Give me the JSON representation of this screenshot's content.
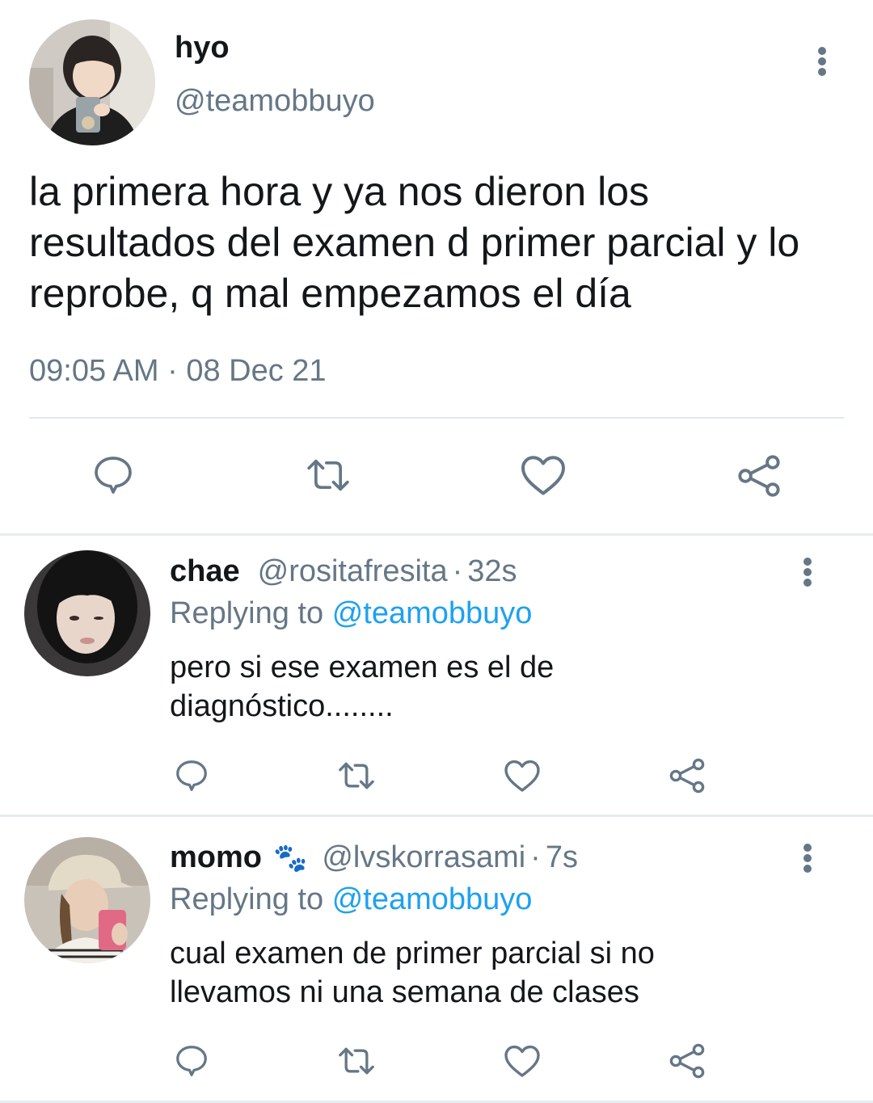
{
  "main_tweet": {
    "display_name": "hyo",
    "handle": "@teamobbuyo",
    "text": "la primera hora y ya nos dieron los resultados del examen d primer parcial y lo reprobe, q mal empezamos el día",
    "timestamp": "09:05 AM · 08 Dec 21",
    "actions": [
      "reply-icon",
      "retweet-icon",
      "like-icon",
      "share-icon"
    ]
  },
  "replies": [
    {
      "display_name": "chae",
      "handle": "@rositafresita",
      "separator": "·",
      "time": "32s",
      "replying_label": "Replying to",
      "replying_to": "@teamobbuyo",
      "text": "pero si ese examen es el de diagnóstico........"
    },
    {
      "display_name": "momo",
      "emoji": "🐾",
      "handle": "@lvskorrasami",
      "separator": "·",
      "time": "7s",
      "replying_label": "Replying to",
      "replying_to": "@teamobbuyo",
      "text": "cual examen de primer parcial si no llevamos ni una semana de clases"
    }
  ],
  "colors": {
    "text": "#14171a",
    "secondary": "#657786",
    "link": "#1da1f2",
    "divider": "#e6ecf0"
  }
}
